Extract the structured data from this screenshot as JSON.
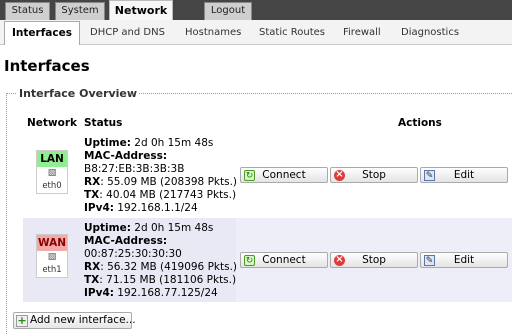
{
  "top_tabs": [
    {
      "label": "Status",
      "active": false
    },
    {
      "label": "System",
      "active": false
    },
    {
      "label": "Network",
      "active": true
    },
    {
      "label": "Logout",
      "active": false
    }
  ],
  "sub_tabs": [
    {
      "label": "Interfaces",
      "active": true
    },
    {
      "label": "DHCP and DNS",
      "active": false
    },
    {
      "label": "Hostnames",
      "active": false
    },
    {
      "label": "Static Routes",
      "active": false
    },
    {
      "label": "Firewall",
      "active": false
    },
    {
      "label": "Diagnostics",
      "active": false
    }
  ],
  "page_title": "Interfaces",
  "overview": {
    "legend": "Interface Overview",
    "columns": {
      "network": "Network",
      "status": "Status",
      "actions": "Actions"
    },
    "rows": [
      {
        "name": "LAN",
        "device": "eth0",
        "uptime_label": "Uptime:",
        "uptime": "2d 0h 15m 48s",
        "mac_label": "MAC-Address:",
        "mac": "B8:27:EB:3B:3B:3B",
        "rx_label": "RX",
        "rx": ": 55.09 MB (208398 Pkts.)",
        "tx_label": "TX",
        "tx": ": 40.04 MB (217743 Pkts.)",
        "ipv4_label": "IPv4:",
        "ipv4": "192.168.1.1/24"
      },
      {
        "name": "WAN",
        "device": "eth1",
        "uptime_label": "Uptime:",
        "uptime": "2d 0h 15m 48s",
        "mac_label": "MAC-Address:",
        "mac": "00:87:25:30:30:30",
        "rx_label": "RX",
        "rx": ": 56.32 MB (419096 Pkts.)",
        "tx_label": "TX",
        "tx": ": 71.15 MB (181106 Pkts.)",
        "ipv4_label": "IPv4:",
        "ipv4": "192.168.77.125/24"
      }
    ],
    "actions": {
      "connect": "Connect",
      "stop": "Stop",
      "edit": "Edit"
    }
  },
  "add_button": "Add new interface...",
  "icons": {
    "connect": "connect-icon",
    "stop": "stop-icon",
    "edit": "edit-icon",
    "add": "add-icon",
    "ethernet": "ethernet-port-icon"
  },
  "colors": {
    "topbar": "#454545",
    "lan_badge": "#90ee90",
    "wan_badge": "#f4a9a9",
    "stop_icon": "#e03a3a",
    "row_alt": "#eeeef8"
  }
}
